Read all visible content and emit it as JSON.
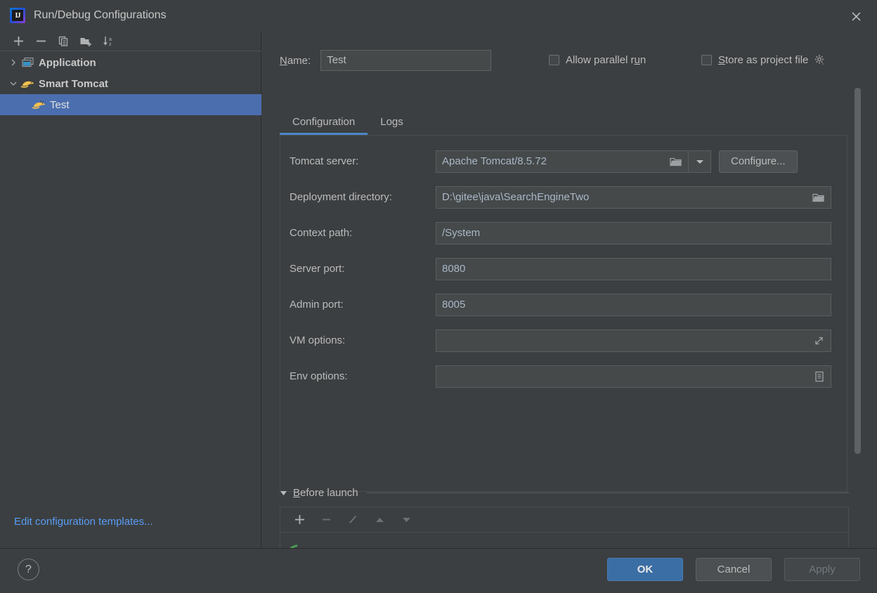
{
  "window": {
    "title": "Run/Debug Configurations",
    "app_icon": "intellij-idea-icon",
    "close_icon": "close-icon"
  },
  "sidebar": {
    "toolbar": [
      {
        "name": "add-configuration-button",
        "icon": "plus-icon",
        "label": "+"
      },
      {
        "name": "remove-configuration-button",
        "icon": "minus-icon",
        "label": "−"
      },
      {
        "name": "copy-configuration-button",
        "icon": "copy-icon",
        "label": "Copy"
      },
      {
        "name": "new-folder-button",
        "icon": "folder-add-icon",
        "label": "New Folder"
      },
      {
        "name": "sort-configurations-button",
        "icon": "sort-alphabetically-icon",
        "label": "Sort"
      }
    ],
    "tree": [
      {
        "label": "Application",
        "icon": "application-window-icon",
        "chevron": "chevron-right-icon",
        "level": 0,
        "bold": true,
        "selected": false
      },
      {
        "label": "Smart Tomcat",
        "icon": "tomcat-cat-icon",
        "chevron": "chevron-down-icon",
        "level": 0,
        "bold": true,
        "selected": false
      },
      {
        "label": "Test",
        "icon": "tomcat-cat-icon",
        "chevron": "",
        "level": 1,
        "bold": false,
        "selected": true
      }
    ],
    "templates_link": "Edit configuration templates..."
  },
  "header": {
    "name_label": "Name:",
    "name_label_mnemonic": "N",
    "name_value": "Test",
    "allow_parallel_run": {
      "label_before": "Allow parallel r",
      "label_mnemonic": "u",
      "label_after": "n",
      "checked": false
    },
    "store_as_project_file": {
      "label_mnemonic": "S",
      "label_after": "tore as project file",
      "checked": false,
      "gear_icon": "gear-dropdown-icon"
    }
  },
  "tabs": [
    {
      "label": "Configuration",
      "active": true
    },
    {
      "label": "Logs",
      "active": false
    }
  ],
  "form": {
    "fields": [
      {
        "label": "Tomcat server:",
        "value": "Apache Tomcat/8.5.72",
        "kind": "combo",
        "browse_icon": "folder-icon",
        "arrow_icon": "chevron-down-icon",
        "button": "Configure..."
      },
      {
        "label": "Deployment directory:",
        "value": "D:\\gitee\\java\\SearchEngineTwo",
        "kind": "browse",
        "browse_icon": "folder-icon"
      },
      {
        "label": "Context path:",
        "value": "/System",
        "kind": "text"
      },
      {
        "label": "Server port:",
        "value": "8080",
        "kind": "text"
      },
      {
        "label": "Admin port:",
        "value": "8005",
        "kind": "text"
      },
      {
        "label": "VM options:",
        "value": "",
        "kind": "expand",
        "trailing_icon": "expand-editor-icon"
      },
      {
        "label": "Env options:",
        "value": "",
        "kind": "list",
        "trailing_icon": "environment-variables-icon"
      }
    ]
  },
  "before_launch": {
    "triangle_icon": "triangle-down-icon",
    "title_mnemonic": "B",
    "title_after": "efore launch",
    "toolbar": [
      {
        "name": "add-task-button",
        "icon": "plus-icon",
        "enabled": true
      },
      {
        "name": "remove-task-button",
        "icon": "minus-icon",
        "enabled": false
      },
      {
        "name": "edit-task-button",
        "icon": "pencil-icon",
        "enabled": false
      },
      {
        "name": "move-task-up-button",
        "icon": "arrow-up-icon",
        "enabled": false
      },
      {
        "name": "move-task-down-button",
        "icon": "arrow-down-icon",
        "enabled": false
      }
    ],
    "item_icon": "build-icon"
  },
  "footer": {
    "help_label": "?",
    "ok_label": "OK",
    "cancel_label": "Cancel",
    "apply_label": "Apply",
    "apply_enabled": false
  },
  "colors": {
    "background": "#3C3F41",
    "selection_blue": "#4B6EAF",
    "link_blue": "#589DF6",
    "tab_underline": "#4A88C7",
    "ok_button": "#3B6EA5",
    "input_background": "#45494A",
    "text": "#BBBBBB",
    "value_text": "#A9B7C6"
  },
  "scrollbar": {
    "name": "content-scrollbar"
  }
}
